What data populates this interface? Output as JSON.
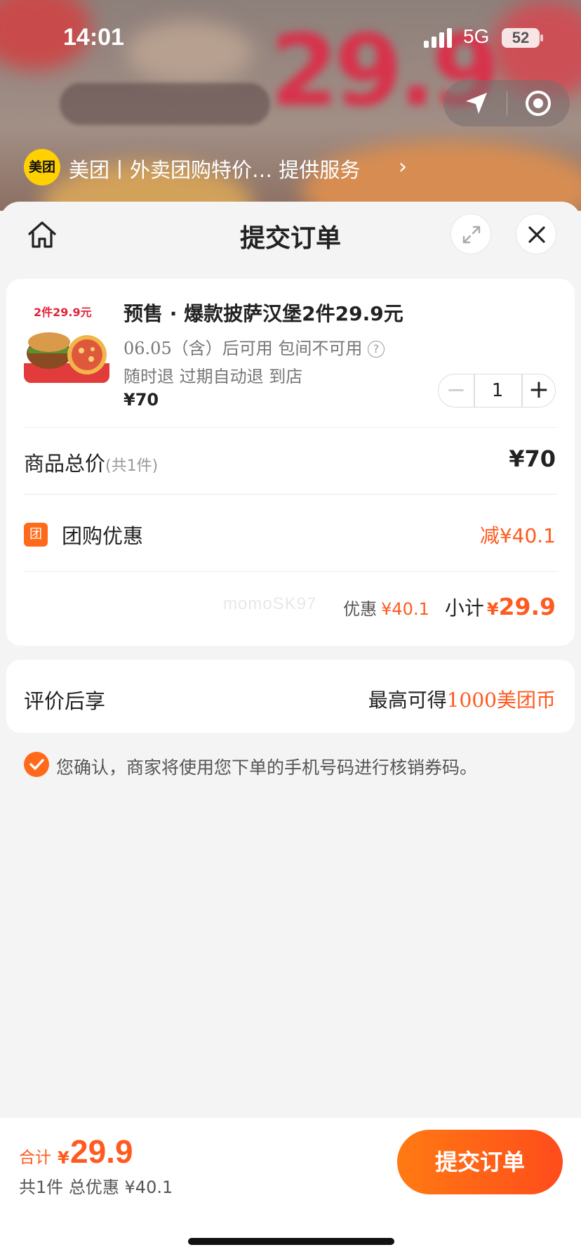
{
  "status_bar": {
    "time": "14:01",
    "network": "5G",
    "battery": "52"
  },
  "provider": {
    "logo_text": "美团",
    "text": "美团丨外卖团购特价…  提供服务",
    "chevron": "›"
  },
  "sheet": {
    "title": "提交订单",
    "icons": [
      "home-icon",
      "expand-icon",
      "close-icon"
    ]
  },
  "product": {
    "thumb_badge": "2件29.9元",
    "title": "预售 · 爆款披萨汉堡2件29.9元",
    "availability": "06.05（含）后可用 包间不可用",
    "tags": "随时退 过期自动退 到店",
    "price": "¥70",
    "quantity": "1",
    "minus": "−",
    "plus": "+"
  },
  "summary": {
    "total_label": "商品总价",
    "total_count": "(共1件)",
    "total_price": "¥70",
    "group_icon_text": "团",
    "group_label": "团购优惠",
    "group_discount": "减¥40.1",
    "watermark": "momoSK97",
    "savings_label": "优惠",
    "savings_value": "¥40.1",
    "subtotal_label": "小计",
    "subtotal_yen": "¥",
    "subtotal_value": "29.9"
  },
  "review": {
    "label": "评价后享",
    "prefix": "最高可得",
    "highlight": "1000美团币"
  },
  "confirm_text": "您确认，商家将使用您下单的手机号码进行核销券码。",
  "bottom_bar": {
    "total_label": "合计",
    "yen": "¥",
    "amount": "29.9",
    "sub_text": "共1件 总优惠 ¥40.1",
    "submit_label": "提交订单"
  },
  "colors": {
    "accent": "#ff5a1f",
    "button_start": "#ff7a12",
    "button_end": "#ff4c1c",
    "logo": "#ffd100"
  }
}
